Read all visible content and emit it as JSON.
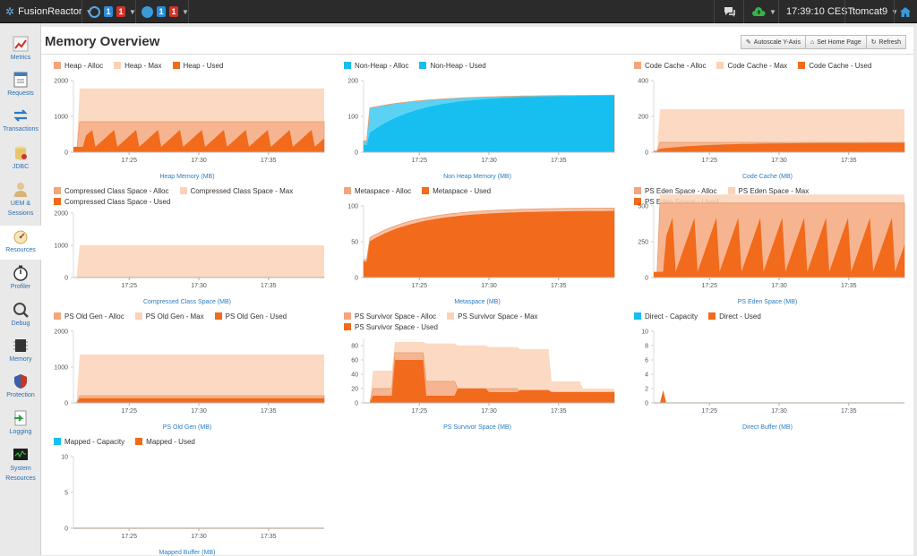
{
  "topbar": {
    "app_name": "FusionReactor",
    "server_badges": [
      "1",
      "1"
    ],
    "cluster_badges": [
      "1",
      "1"
    ],
    "time": "17:39:10 CEST",
    "instance": "tomcat9"
  },
  "sidebar": {
    "items": [
      {
        "label": "Metrics",
        "icon": "metrics-icon"
      },
      {
        "label": "Requests",
        "icon": "requests-icon"
      },
      {
        "label": "Transactions",
        "icon": "transactions-icon"
      },
      {
        "label": "JDBC",
        "icon": "jdbc-icon"
      },
      {
        "label": "UEM &",
        "label2": "Sessions",
        "icon": "uem-icon"
      },
      {
        "label": "Resources",
        "icon": "resources-icon"
      },
      {
        "label": "Profiler",
        "icon": "profiler-icon"
      },
      {
        "label": "Debug",
        "icon": "debug-icon"
      },
      {
        "label": "Memory",
        "icon": "memory-icon"
      },
      {
        "label": "Protection",
        "icon": "protection-icon"
      },
      {
        "label": "Logging",
        "icon": "logging-icon"
      },
      {
        "label": "System",
        "label2": "Resources",
        "icon": "system-resources-icon"
      }
    ]
  },
  "page": {
    "title": "Memory Overview",
    "buttons": {
      "autoscale": "Autoscale Y-Axis",
      "home": "Set Home Page",
      "refresh": "Refresh"
    }
  },
  "colors": {
    "alloc": "#f4a57b",
    "max": "#fbd2b7",
    "used": "#f26a1b",
    "nonheap": "#16bff0",
    "axis": "#aaaaaa"
  },
  "chart_data": [
    {
      "type": "area",
      "id": "heap",
      "xlabel": "Heap Memory (MB)",
      "xticks": [
        "17:25",
        "17:30",
        "17:35"
      ],
      "yticks": [
        0,
        1000,
        2000
      ],
      "ylim": [
        0,
        2000
      ],
      "x": [
        "17:21",
        "17:39"
      ],
      "series": [
        {
          "name": "Heap - Alloc",
          "color": "#f4a57b",
          "value": 850
        },
        {
          "name": "Heap - Max",
          "color": "#fbd2b7",
          "value": 1780
        },
        {
          "name": "Heap - Used",
          "color": "#f26a1b",
          "pattern": "sawtooth",
          "low": 150,
          "high": 700
        }
      ]
    },
    {
      "type": "area",
      "id": "nonheap",
      "xlabel": "Non Heap Memory (MB)",
      "xticks": [
        "17:25",
        "17:30",
        "17:35"
      ],
      "yticks": [
        0,
        100,
        200
      ],
      "ylim": [
        0,
        200
      ],
      "x": [
        "17:21",
        "17:39"
      ],
      "series": [
        {
          "name": "Non-Heap - Alloc",
          "color": "#16bff0",
          "value_end": 160
        },
        {
          "name": "Non-Heap - Used",
          "color": "#16bff0",
          "pattern": "rise",
          "start": 40,
          "end": 158
        }
      ]
    },
    {
      "type": "area",
      "id": "codecache",
      "xlabel": "Code Cache (MB)",
      "xticks": [
        "17:25",
        "17:30",
        "17:35"
      ],
      "yticks": [
        0,
        200,
        400
      ],
      "ylim": [
        0,
        400
      ],
      "x": [
        "17:21",
        "17:39"
      ],
      "series": [
        {
          "name": "Code Cache - Alloc",
          "color": "#f4a57b",
          "value": 55
        },
        {
          "name": "Code Cache - Max",
          "color": "#fbd2b7",
          "value": 240
        },
        {
          "name": "Code Cache - Used",
          "color": "#f26a1b",
          "pattern": "rise",
          "start": 15,
          "end": 52
        }
      ]
    },
    {
      "type": "area",
      "id": "compressed",
      "xlabel": "Compressed Class Space (MB)",
      "xticks": [
        "17:25",
        "17:30",
        "17:35"
      ],
      "yticks": [
        0,
        1000,
        2000
      ],
      "ylim": [
        0,
        2000
      ],
      "x": [
        "17:21",
        "17:39"
      ],
      "series": [
        {
          "name": "Compressed Class Space - Alloc",
          "color": "#f4a57b",
          "value": 12
        },
        {
          "name": "Compressed Class Space - Max",
          "color": "#fbd2b7",
          "value": 1000
        },
        {
          "name": "Compressed Class Space - Used",
          "color": "#f26a1b",
          "value": 10
        }
      ]
    },
    {
      "type": "area",
      "id": "metaspace",
      "xlabel": "Metaspace (MB)",
      "xticks": [
        "17:25",
        "17:30",
        "17:35"
      ],
      "yticks": [
        0,
        50,
        100
      ],
      "ylim": [
        0,
        100
      ],
      "x": [
        "17:21",
        "17:39"
      ],
      "series": [
        {
          "name": "Metaspace - Alloc",
          "color": "#f4a57b",
          "pattern": "rise",
          "start": 50,
          "end": 97
        },
        {
          "name": "Metaspace - Used",
          "color": "#f26a1b",
          "pattern": "rise",
          "start": 45,
          "end": 93
        }
      ]
    },
    {
      "type": "area",
      "id": "eden",
      "xlabel": "PS Eden Space (MB)",
      "xticks": [
        "17:25",
        "17:30",
        "17:35"
      ],
      "yticks": [
        0,
        250,
        500
      ],
      "ylim": [
        0,
        500
      ],
      "x": [
        "17:21",
        "17:39"
      ],
      "series": [
        {
          "name": "PS Eden Space - Alloc",
          "color": "#f4a57b",
          "value": 520
        },
        {
          "name": "PS Eden Space - Max",
          "color": "#fbd2b7",
          "value": 580
        },
        {
          "name": "PS Eden Space - Used",
          "color": "#f26a1b",
          "pattern": "sawtooth",
          "low": 40,
          "high": 480
        }
      ]
    },
    {
      "type": "area",
      "id": "oldgen",
      "xlabel": "PS Old Gen (MB)",
      "xticks": [
        "17:25",
        "17:30",
        "17:35"
      ],
      "yticks": [
        0,
        1000,
        2000
      ],
      "ylim": [
        0,
        2000
      ],
      "x": [
        "17:21",
        "17:39"
      ],
      "series": [
        {
          "name": "PS Old Gen - Alloc",
          "color": "#f4a57b",
          "value": 200
        },
        {
          "name": "PS Old Gen - Max",
          "color": "#fbd2b7",
          "value": 1350
        },
        {
          "name": "PS Old Gen - Used",
          "color": "#f26a1b",
          "value": 130
        }
      ]
    },
    {
      "type": "area",
      "id": "survivor",
      "xlabel": "PS Survivor Space (MB)",
      "xticks": [
        "17:25",
        "17:30",
        "17:35"
      ],
      "yticks": [
        0,
        20,
        40,
        60,
        80
      ],
      "ylim": [
        0,
        90
      ],
      "x": [
        "17:21",
        "17:39"
      ],
      "series": [
        {
          "name": "PS Survivor Space - Alloc",
          "color": "#f4a57b",
          "pattern": "steps",
          "values": [
            20,
            70,
            30,
            20,
            20,
            15,
            15,
            15
          ]
        },
        {
          "name": "PS Survivor Space - Max",
          "color": "#fbd2b7",
          "pattern": "steps",
          "values": [
            45,
            85,
            83,
            80,
            78,
            75,
            30,
            20
          ]
        },
        {
          "name": "PS Survivor Space - Used",
          "color": "#f26a1b",
          "pattern": "steps",
          "values": [
            10,
            60,
            10,
            20,
            15,
            18,
            15,
            15
          ]
        }
      ]
    },
    {
      "type": "area",
      "id": "direct",
      "xlabel": "Direct Buffer (MB)",
      "xticks": [
        "17:25",
        "17:30",
        "17:35"
      ],
      "yticks": [
        0,
        2,
        4,
        6,
        8,
        10
      ],
      "ylim": [
        0,
        10
      ],
      "x": [
        "17:21",
        "17:39"
      ],
      "series": [
        {
          "name": "Direct - Capacity",
          "color": "#16bff0",
          "value": 0
        },
        {
          "name": "Direct - Used",
          "color": "#f26a1b",
          "pattern": "spike",
          "value": 0
        }
      ]
    },
    {
      "type": "area",
      "id": "mapped",
      "xlabel": "Mapped Buffer (MB)",
      "xticks": [
        "17:25",
        "17:30",
        "17:35"
      ],
      "yticks": [
        0,
        5,
        10
      ],
      "ylim": [
        0,
        10
      ],
      "x": [
        "17:21",
        "17:39"
      ],
      "series": [
        {
          "name": "Mapped - Capacity",
          "color": "#16bff0",
          "value": 0
        },
        {
          "name": "Mapped - Used",
          "color": "#f26a1b",
          "value": 0
        }
      ]
    }
  ]
}
